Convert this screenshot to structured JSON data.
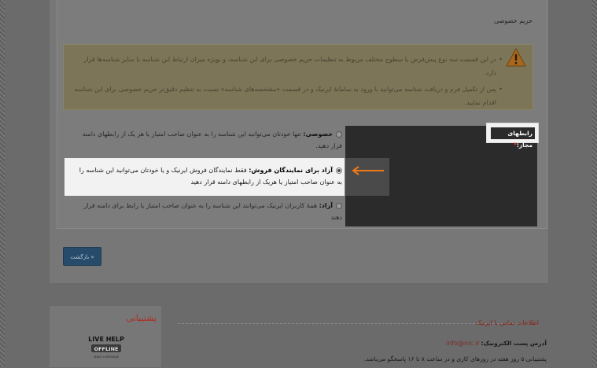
{
  "privacy": {
    "title": "حریم خصوصی",
    "warnings": [
      "در این قسمت سه نوع پیش‌فرض یا سطوح مختلف مربوط به تنظیمات حریم خصوصی برای این شناسه، و بویژه میزان ارتباط این شناسه با سایر شناسه‌ها قرار دارد.",
      "پس از تکمیل فرم و دریافت شناسه می‌توانید با ورود به سامانهٔ ایرنیک و در قسمت «مشخصه‌های شناسه» نسبت به تنظیم دقیق‌تر حریم خصوصی برای این شناسه اقدام نمایید."
    ]
  },
  "allowed_links": {
    "label": "رابطهای مجاز:",
    "required_mark": "*"
  },
  "options": {
    "private": {
      "title": "خصوصی:",
      "text": "تنها خودتان می‌توانید این شناسه را به عنوان صاحب امتیاز یا هر یک از رابطهای دامنه قرار دهید."
    },
    "resellers": {
      "title": "آزاد برای نمایندگان فروش:",
      "text": "فقط نمایندگان فروش ایرنیک و یا خودتان می‌توانید این شناسه را به عنوان صاحب امتیاز یا هریک از رابطهای دامنه قرار دهید"
    },
    "public": {
      "title": "آزاد:",
      "text": "همهٔ کاربران ایرنیک می‌توانند این شناسه را به عنوان صاحب امتیاز یا رابط برای دامنه قرار دهند"
    }
  },
  "back_button": "بازگشت »",
  "support": {
    "title": "پشتیبانی",
    "badge_top": "LIVE HELP",
    "badge_middle": "OFFLINE",
    "badge_bottom": "LEAVE A MESSAGE"
  },
  "contact": {
    "title": "اطلاعات تماس با ایرنیک",
    "email_label": "آدرس پست الکترونیک:",
    "email": "info@nic.ir",
    "support_line": "پشتیبانی ۵ روز هفته در روزهای کاری و در ساعت ۸ تا ۱۶ پاسخگو می‌باشد."
  },
  "colors": {
    "accent_orange": "#f07a1a",
    "button_blue": "#274b6b",
    "support_red": "#b02a1e"
  }
}
